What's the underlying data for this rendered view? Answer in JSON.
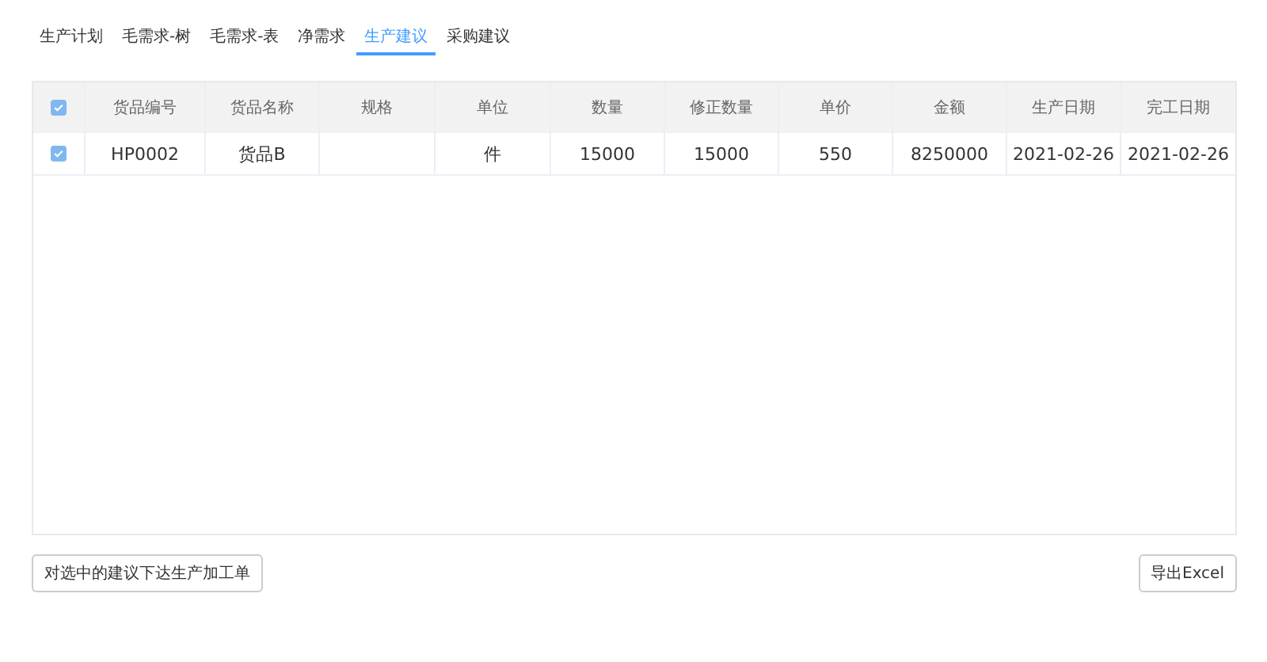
{
  "tabs": [
    {
      "label": "生产计划",
      "selected": false
    },
    {
      "label": "毛需求-树",
      "selected": false
    },
    {
      "label": "毛需求-表",
      "selected": false
    },
    {
      "label": "净需求",
      "selected": false
    },
    {
      "label": "生产建议",
      "selected": true
    },
    {
      "label": "采购建议",
      "selected": false
    }
  ],
  "table": {
    "all_checked": true,
    "columns": [
      "货品编号",
      "货品名称",
      "规格",
      "单位",
      "数量",
      "修正数量",
      "单价",
      "金额",
      "生产日期",
      "完工日期"
    ],
    "rows": [
      {
        "checked": true,
        "cells": [
          "HP0002",
          "货品B",
          "",
          "件",
          "15000",
          "15000",
          "550",
          "8250000",
          "2021-02-26",
          "2021-02-26"
        ]
      }
    ]
  },
  "buttons": {
    "issue": "对选中的建议下达生产加工单",
    "export": "导出Excel"
  }
}
